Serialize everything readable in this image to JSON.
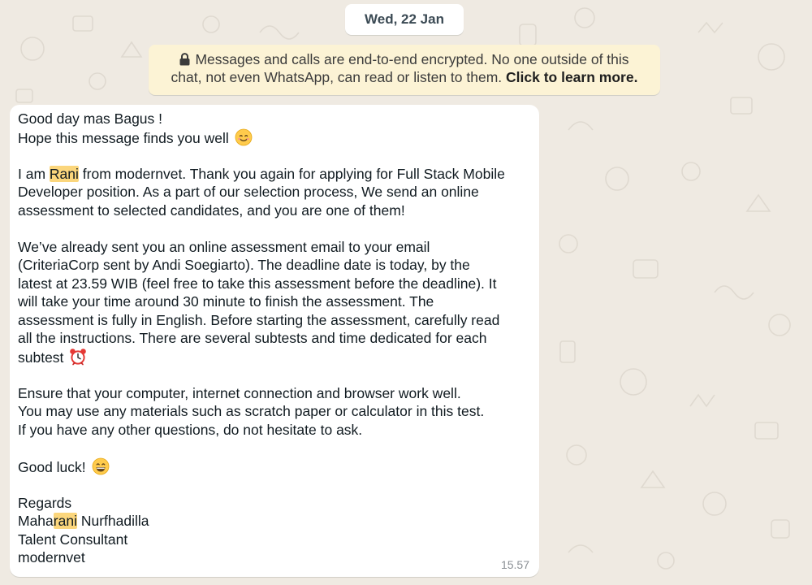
{
  "chat": {
    "date_chip": "Wed, 22 Jan",
    "encryption_notice": {
      "icon": "lock-icon",
      "line1": "Messages and calls are end-to-end encrypted. No one outside of this",
      "line2": "chat, not even WhatsApp, can read or listen to them.",
      "link": "Click to learn more."
    },
    "message": {
      "lines": {
        "l1": "Good day mas Bagus !",
        "l2": "Hope this message finds you well",
        "l3_pre": "I am ",
        "l3_hl": "Rani",
        "l3_post": " from modernvet. Thank you again for applying for Full Stack Mobile",
        "l4": "Developer position. As a part of our selection process, We send an online",
        "l5": "assessment to selected candidates, and you are one of them!",
        "l6": "We’ve already sent you an online assessment email to your email",
        "l7": "(CriteriaCorp sent by Andi Soegiarto). The deadline date is today, by the",
        "l8": "latest at 23.59 WIB (feel free to take this assessment before the deadline). It",
        "l9": "will take your time around 30 minute to finish the assessment. The",
        "l10": "assessment is fully in English. Before starting the assessment, carefully read",
        "l11": "all the instructions. There are several subtests and time dedicated for each",
        "l12": "subtest",
        "l13": "Ensure that your computer, internet connection and browser work well.",
        "l14": "You may use any materials such as scratch paper or calculator in this test.",
        "l15": "If you have any other questions, do not hesitate to ask.",
        "l16": "Good luck!",
        "l17": "Regards",
        "l18_pre": "Maha",
        "l18_hl": "rani",
        "l18_post": " Nurfhadilla",
        "l19": "Talent Consultant",
        "l20": "modernvet"
      },
      "emojis": {
        "smile": "smiling-face-emoji",
        "alarm": "alarm-clock-emoji",
        "grin": "grinning-face-emoji"
      },
      "highlight_color": "#fbd67c",
      "timestamp": "15.57"
    }
  }
}
